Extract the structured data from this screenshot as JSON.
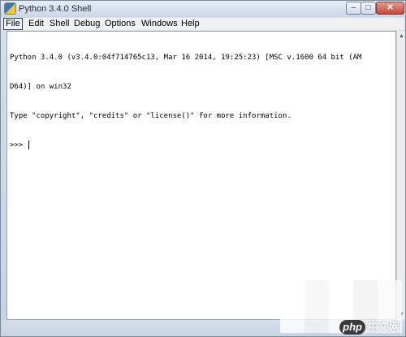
{
  "window": {
    "title": "Python 3.4.0 Shell",
    "buttons": {
      "minimize": "–",
      "maximize": "□",
      "close": "✕"
    }
  },
  "menubar": {
    "items": [
      {
        "label": "File",
        "active": true
      },
      {
        "label": "Edit"
      },
      {
        "label": "Shell"
      },
      {
        "label": "Debug"
      },
      {
        "label": "Options"
      },
      {
        "label": "Windows"
      },
      {
        "label": "Help"
      }
    ]
  },
  "console": {
    "lines": [
      "Python 3.4.0 (v3.4.0:04f714765c13, Mar 16 2014, 19:25:23) [MSC v.1600 64 bit (AM",
      "D64)] on win32",
      "Type \"copyright\", \"credits\" or \"license()\" for more information."
    ],
    "prompt": ">>> "
  },
  "scrollbar": {
    "up_arrow": "▲",
    "down_arrow": "▼"
  },
  "watermark": {
    "brand": "php",
    "site": "中文网"
  },
  "colors": {
    "chrome": "#c4d2e2",
    "close_button": "#c5473a",
    "text": "#000000"
  }
}
